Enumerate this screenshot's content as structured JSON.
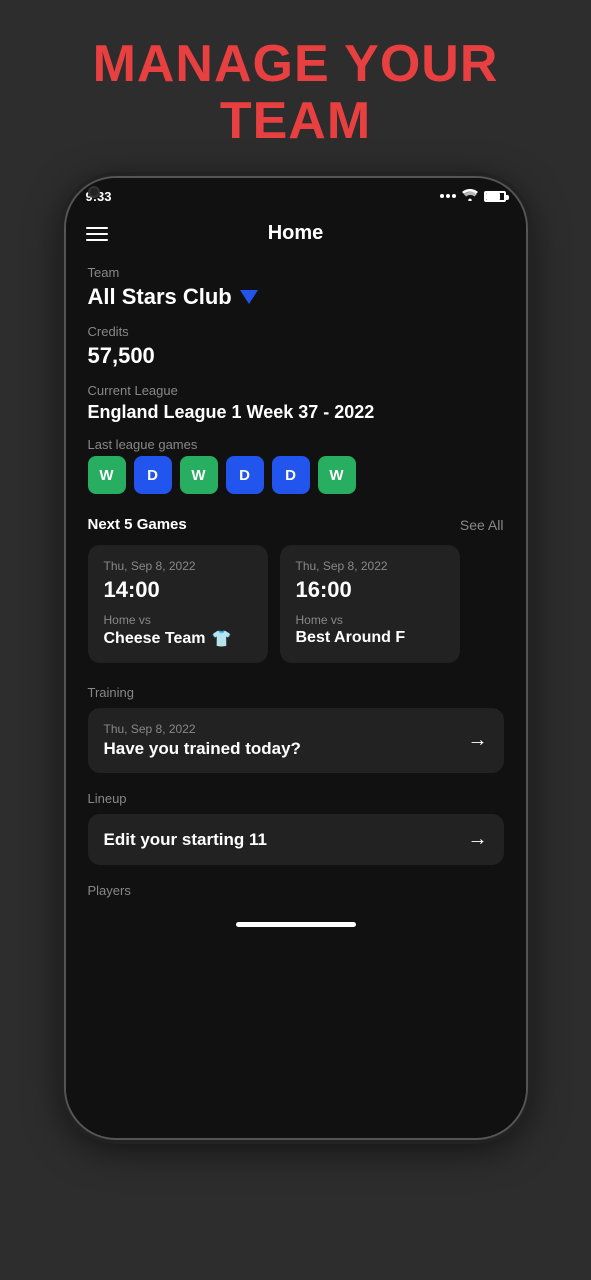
{
  "page": {
    "title_line1": "MANAGE YOUR",
    "title_line2": "TEAM"
  },
  "status_bar": {
    "time": "9:33",
    "signal_dots": 3
  },
  "nav": {
    "title": "Home"
  },
  "team": {
    "label": "Team",
    "name": "All Stars Club"
  },
  "credits": {
    "label": "Credits",
    "value": "57,500"
  },
  "league": {
    "label": "Current League",
    "name": "England League 1 Week 37 - 2022"
  },
  "last_games": {
    "label": "Last league games",
    "results": [
      {
        "result": "W",
        "type": "win"
      },
      {
        "result": "D",
        "type": "draw"
      },
      {
        "result": "W",
        "type": "win"
      },
      {
        "result": "D",
        "type": "draw"
      },
      {
        "result": "D",
        "type": "draw"
      },
      {
        "result": "W",
        "type": "win"
      }
    ]
  },
  "next_games": {
    "label": "Next 5 Games",
    "see_all": "See All",
    "games": [
      {
        "date": "Thu, Sep 8, 2022",
        "time": "14:00",
        "vs_label": "Home vs",
        "team": "Cheese Team",
        "has_shirt": true,
        "shirt_color": "#27ae60"
      },
      {
        "date": "Thu, Sep 8, 2022",
        "time": "16:00",
        "vs_label": "Home vs",
        "team": "Best Around F",
        "has_shirt": false
      }
    ]
  },
  "training": {
    "label": "Training",
    "date": "Thu, Sep 8, 2022",
    "question": "Have you trained today?"
  },
  "lineup": {
    "label": "Lineup",
    "action": "Edit your starting 11"
  },
  "players": {
    "label": "Players"
  },
  "icons": {
    "hamburger": "menu",
    "arrow_right": "→",
    "shirt": "👕"
  }
}
